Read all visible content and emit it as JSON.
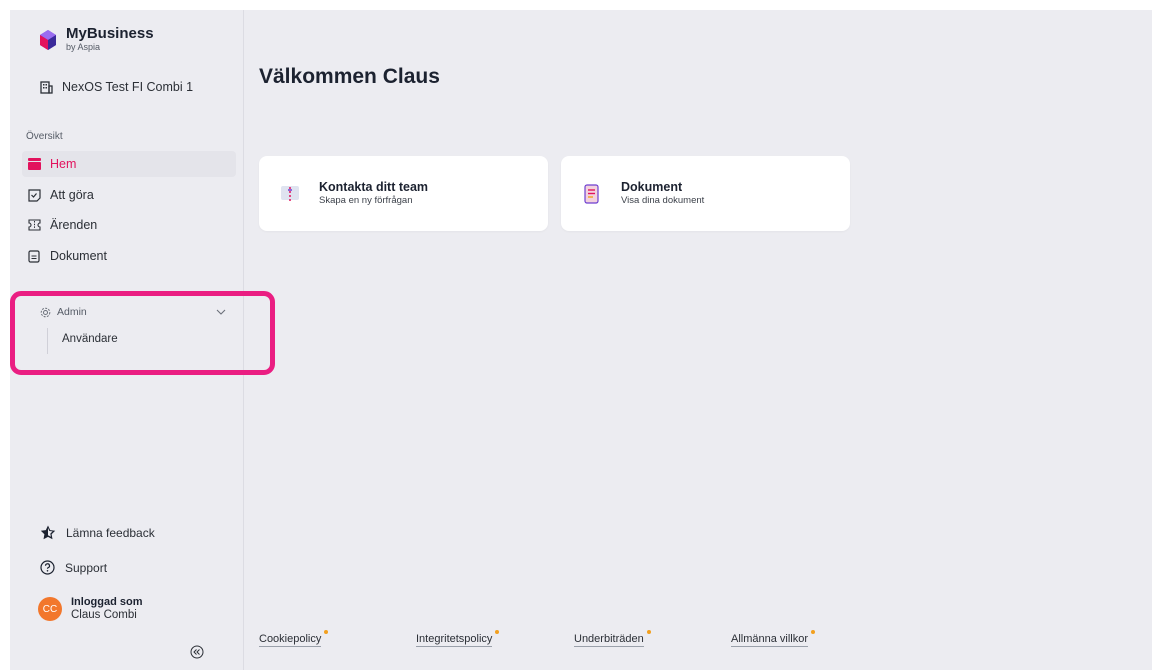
{
  "brand": {
    "title": "MyBusiness",
    "subtitle": "by Aspia",
    "accent": "#e2125d"
  },
  "company": {
    "name": "NexOS Test FI Combi 1",
    "icon": "building-icon"
  },
  "sidebar": {
    "section_label": "Översikt",
    "items": [
      {
        "label": "Hem",
        "icon": "home-icon",
        "active": true
      },
      {
        "label": "Att göra",
        "icon": "todo-icon",
        "active": false
      },
      {
        "label": "Ärenden",
        "icon": "ticket-icon",
        "active": false
      },
      {
        "label": "Dokument",
        "icon": "document-icon",
        "active": false
      }
    ],
    "admin": {
      "label": "Admin",
      "icon": "gear-icon",
      "expanded": true,
      "subitems": [
        {
          "label": "Användare"
        }
      ]
    },
    "footer": {
      "feedback": "Lämna feedback",
      "support": "Support"
    },
    "user": {
      "initials": "CC",
      "label": "Inloggad som",
      "name": "Claus Combi",
      "avatar_color": "#f2772c"
    }
  },
  "main": {
    "welcome": "Välkommen Claus",
    "cards": [
      {
        "title": "Kontakta ditt team",
        "subtitle": "Skapa en ny förfrågan",
        "icon": "team-contact-icon"
      },
      {
        "title": "Dokument",
        "subtitle": "Visa dina dokument",
        "icon": "document-icon"
      }
    ],
    "footer_links": [
      {
        "label": "Cookiepolicy"
      },
      {
        "label": "Integritetspolicy"
      },
      {
        "label": "Underbiträden"
      },
      {
        "label": "Allmänna villkor"
      }
    ]
  },
  "highlight_color": "#ea1e82"
}
